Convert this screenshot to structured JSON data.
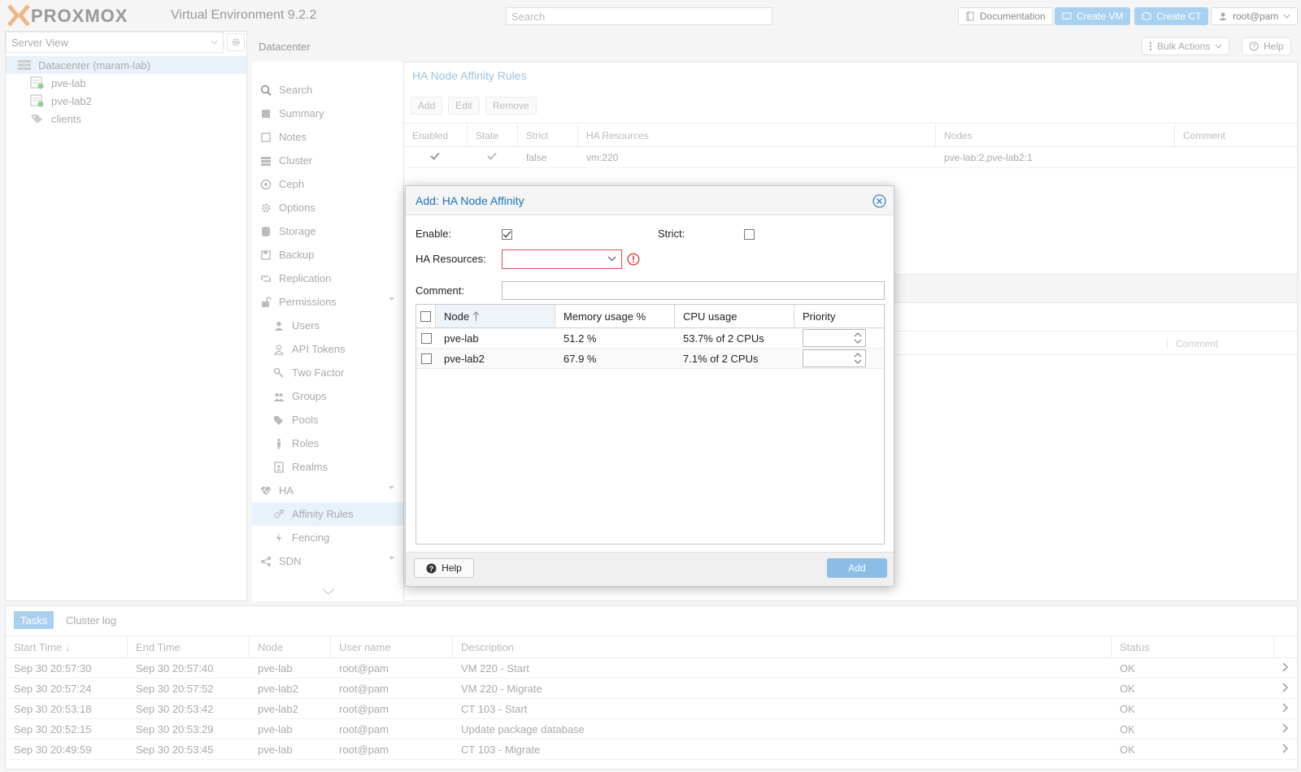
{
  "header": {
    "logo": "PROXMOX",
    "version": "Virtual Environment 9.2.2",
    "search_placeholder": "Search",
    "documentation": "Documentation",
    "create_vm": "Create VM",
    "create_ct": "Create CT",
    "user": "root@pam"
  },
  "tree": {
    "view": "Server View",
    "items": [
      {
        "label": "Datacenter (maram-lab)",
        "icon": "datacenter-icon"
      },
      {
        "label": "pve-lab",
        "icon": "node-icon"
      },
      {
        "label": "pve-lab2",
        "icon": "node-icon"
      },
      {
        "label": "clients",
        "icon": "tag-icon"
      }
    ]
  },
  "breadcrumb": "Datacenter",
  "toolbar": {
    "bulk_actions": "Bulk Actions",
    "help": "Help"
  },
  "menu": {
    "items": [
      "Search",
      "Summary",
      "Notes",
      "Cluster",
      "Ceph",
      "Options",
      "Storage",
      "Backup",
      "Replication",
      "Permissions",
      "Users",
      "API Tokens",
      "Two Factor",
      "Groups",
      "Pools",
      "Roles",
      "Realms",
      "HA",
      "Affinity Rules",
      "Fencing",
      "SDN"
    ]
  },
  "panel": {
    "title": "HA Node Affinity Rules",
    "buttons": [
      "Add",
      "Edit",
      "Remove"
    ],
    "columns": [
      "Enabled",
      "State",
      "Strict",
      "HA Resources",
      "Nodes",
      "Comment"
    ],
    "row": {
      "strict": "false",
      "resources": "vm:220",
      "nodes": "pve-lab:2,pve-lab2:1"
    },
    "comment_bg": "Comment"
  },
  "dialog": {
    "title": "Add: HA Node Affinity",
    "enable_label": "Enable:",
    "enable_checked": true,
    "strict_label": "Strict:",
    "strict_checked": false,
    "ha_resources_label": "HA Resources:",
    "ha_resources_value": "",
    "comment_label": "Comment:",
    "comment_value": "",
    "grid": {
      "columns": [
        "Node",
        "Memory usage %",
        "CPU usage",
        "Priority"
      ],
      "rows": [
        {
          "node": "pve-lab",
          "memory": "51.2 %",
          "cpu": "53.7% of 2 CPUs",
          "priority": ""
        },
        {
          "node": "pve-lab2",
          "memory": "67.9 %",
          "cpu": "7.1% of 2 CPUs",
          "priority": ""
        }
      ]
    },
    "help": "Help",
    "add": "Add"
  },
  "tasks": {
    "tabs": [
      "Tasks",
      "Cluster log"
    ],
    "columns": [
      "Start Time",
      "End Time",
      "Node",
      "User name",
      "Description",
      "Status"
    ],
    "rows": [
      {
        "start": "Sep 30 20:57:30",
        "end": "Sep 30 20:57:40",
        "node": "pve-lab",
        "user": "root@pam",
        "desc": "VM 220 - Start",
        "status": "OK"
      },
      {
        "start": "Sep 30 20:57:24",
        "end": "Sep 30 20:57:52",
        "node": "pve-lab2",
        "user": "root@pam",
        "desc": "VM 220 - Migrate",
        "status": "OK"
      },
      {
        "start": "Sep 30 20:53:18",
        "end": "Sep 30 20:53:42",
        "node": "pve-lab2",
        "user": "root@pam",
        "desc": "CT 103 - Start",
        "status": "OK"
      },
      {
        "start": "Sep 30 20:52:15",
        "end": "Sep 30 20:53:29",
        "node": "pve-lab",
        "user": "root@pam",
        "desc": "Update package database",
        "status": "OK"
      },
      {
        "start": "Sep 30 20:49:59",
        "end": "Sep 30 20:53:45",
        "node": "pve-lab",
        "user": "root@pam",
        "desc": "CT 103 - Migrate",
        "status": "OK"
      }
    ]
  }
}
